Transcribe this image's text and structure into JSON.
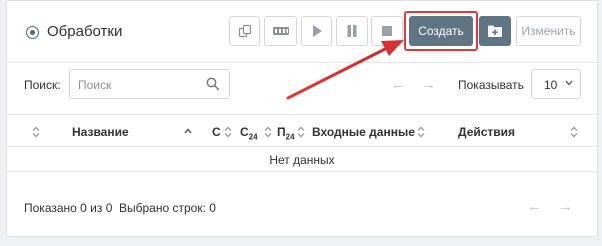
{
  "header": {
    "title": "Обработки",
    "create_label": "Создать",
    "edit_label": "Изменить"
  },
  "search": {
    "label": "Поиск:",
    "placeholder": "Поиск",
    "value": ""
  },
  "pagination_top": {
    "prev": "←",
    "next": "→",
    "show_label": "Показывать",
    "page_size": "10"
  },
  "table": {
    "columns": {
      "name": "Название",
      "c": "С",
      "c24_base": "С",
      "c24_sub": "24",
      "p24_base": "П",
      "p24_sub": "24",
      "input": "Входные данные",
      "actions": "Действия"
    },
    "empty_text": "Нет данных"
  },
  "footer": {
    "shown": "Показано 0 из 0",
    "selected": "Выбрано строк: 0",
    "prev": "←",
    "next": "→"
  },
  "colors": {
    "primary_button": "#5f7584",
    "highlight": "#e0393c"
  }
}
